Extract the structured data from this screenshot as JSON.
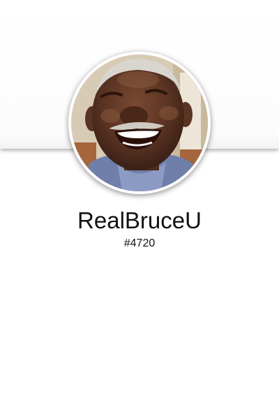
{
  "profile": {
    "avatar_icon": "user-photo-avatar",
    "username": "RealBruceU",
    "tag": "#4720"
  },
  "colors": {
    "background": "#ffffff",
    "text": "#111111"
  }
}
